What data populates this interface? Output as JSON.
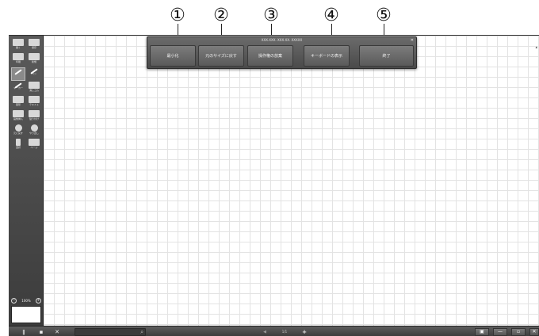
{
  "callouts": [
    "①",
    "②",
    "③",
    "④",
    "⑤"
  ],
  "top_menu": {
    "title": "XXX.XXX. XXX.XX. XXXXX",
    "buttons": [
      "最小化",
      "元のサイズに戻す",
      "操作権の放棄",
      "キーボードの表示",
      "終了"
    ]
  },
  "sidebar": {
    "tools": [
      {
        "label": "開く",
        "icon": "folder-icon"
      },
      {
        "label": "保存",
        "icon": "save-icon"
      },
      {
        "label": "印刷",
        "icon": "print-icon"
      },
      {
        "label": "新規",
        "icon": "new-page-icon"
      },
      {
        "label": "",
        "icon": "select-pointer-icon",
        "active": true
      },
      {
        "label": "ペン",
        "icon": "pen-icon"
      },
      {
        "label": "マーカー",
        "icon": "marker-icon"
      },
      {
        "label": "消しゴム",
        "icon": "eraser-icon"
      },
      {
        "label": "図形",
        "icon": "shape-icon"
      },
      {
        "label": "テキスト",
        "icon": "text-icon"
      },
      {
        "label": "画像挿入",
        "icon": "image-icon"
      },
      {
        "label": "貼り付け",
        "icon": "paste-icon"
      },
      {
        "label": "元に戻す",
        "icon": "undo-icon"
      },
      {
        "label": "やり直し",
        "icon": "redo-icon"
      },
      {
        "label": "選択",
        "icon": "cursor-icon"
      },
      {
        "label": "ページ",
        "icon": "page-icon"
      }
    ],
    "zoom": "100%"
  },
  "bottom_bar": {
    "page_indicator": "1/1",
    "add_page": "+",
    "prev_page": "◀"
  },
  "colors": {
    "toolbar": "#4a4a4a",
    "grid": "#e3e3e3",
    "menu_button": "#6a6a6a"
  }
}
